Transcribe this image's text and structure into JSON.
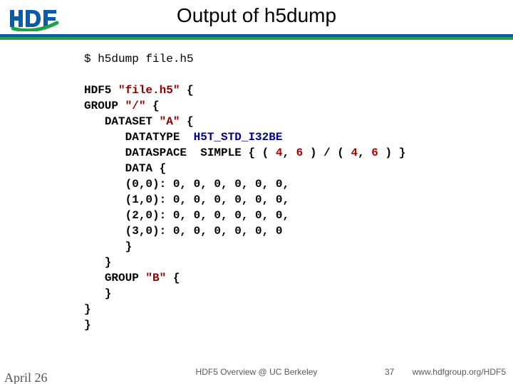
{
  "header": {
    "logo_text": "HDF",
    "title": "Output of h5dump"
  },
  "terminal": {
    "prompt": "$ h5dump file.h5",
    "lines": [
      [
        [
          "kw",
          "HDF5 "
        ],
        [
          "str",
          "\"file.h5\""
        ],
        [
          "pun",
          " {"
        ]
      ],
      [
        [
          "kw",
          "GROUP "
        ],
        [
          "str",
          "\"/\""
        ],
        [
          "pun",
          " {"
        ]
      ],
      [
        [
          "pun",
          "   "
        ],
        [
          "kw",
          "DATASET "
        ],
        [
          "str",
          "\"A\""
        ],
        [
          "pun",
          " {"
        ]
      ],
      [
        [
          "pun",
          "      "
        ],
        [
          "kw",
          "DATATYPE  "
        ],
        [
          "typ",
          "H5T_STD_I32BE"
        ]
      ],
      [
        [
          "pun",
          "      "
        ],
        [
          "kw",
          "DATASPACE  SIMPLE "
        ],
        [
          "pun",
          "{ ( "
        ],
        [
          "num",
          "4"
        ],
        [
          "pun",
          ", "
        ],
        [
          "num",
          "6"
        ],
        [
          "pun",
          " ) / ( "
        ],
        [
          "num",
          "4"
        ],
        [
          "pun",
          ", "
        ],
        [
          "num",
          "6"
        ],
        [
          "pun",
          " ) }"
        ]
      ],
      [
        [
          "pun",
          "      "
        ],
        [
          "kw",
          "DATA "
        ],
        [
          "pun",
          "{"
        ]
      ],
      [
        [
          "pun",
          "      "
        ],
        [
          "dat",
          "(0,0): 0, 0, 0, 0, 0, 0,"
        ]
      ],
      [
        [
          "pun",
          "      "
        ],
        [
          "dat",
          "(1,0): 0, 0, 0, 0, 0, 0,"
        ]
      ],
      [
        [
          "pun",
          "      "
        ],
        [
          "dat",
          "(2,0): 0, 0, 0, 0, 0, 0,"
        ]
      ],
      [
        [
          "pun",
          "      "
        ],
        [
          "dat",
          "(3,0): 0, 0, 0, 0, 0, 0"
        ]
      ],
      [
        [
          "pun",
          "      }"
        ]
      ],
      [
        [
          "pun",
          "   }"
        ]
      ],
      [
        [
          "pun",
          "   "
        ],
        [
          "kw",
          "GROUP "
        ],
        [
          "str",
          "\"B\""
        ],
        [
          "pun",
          " {"
        ]
      ],
      [
        [
          "pun",
          "   }"
        ]
      ],
      [
        [
          "pun",
          "}"
        ]
      ],
      [
        [
          "pun",
          "}"
        ]
      ]
    ]
  },
  "footer": {
    "date": "April 26",
    "center": "HDF5 Overview @ UC Berkeley",
    "page": "37",
    "url": "www.hdfgroup.org/HDF5"
  }
}
